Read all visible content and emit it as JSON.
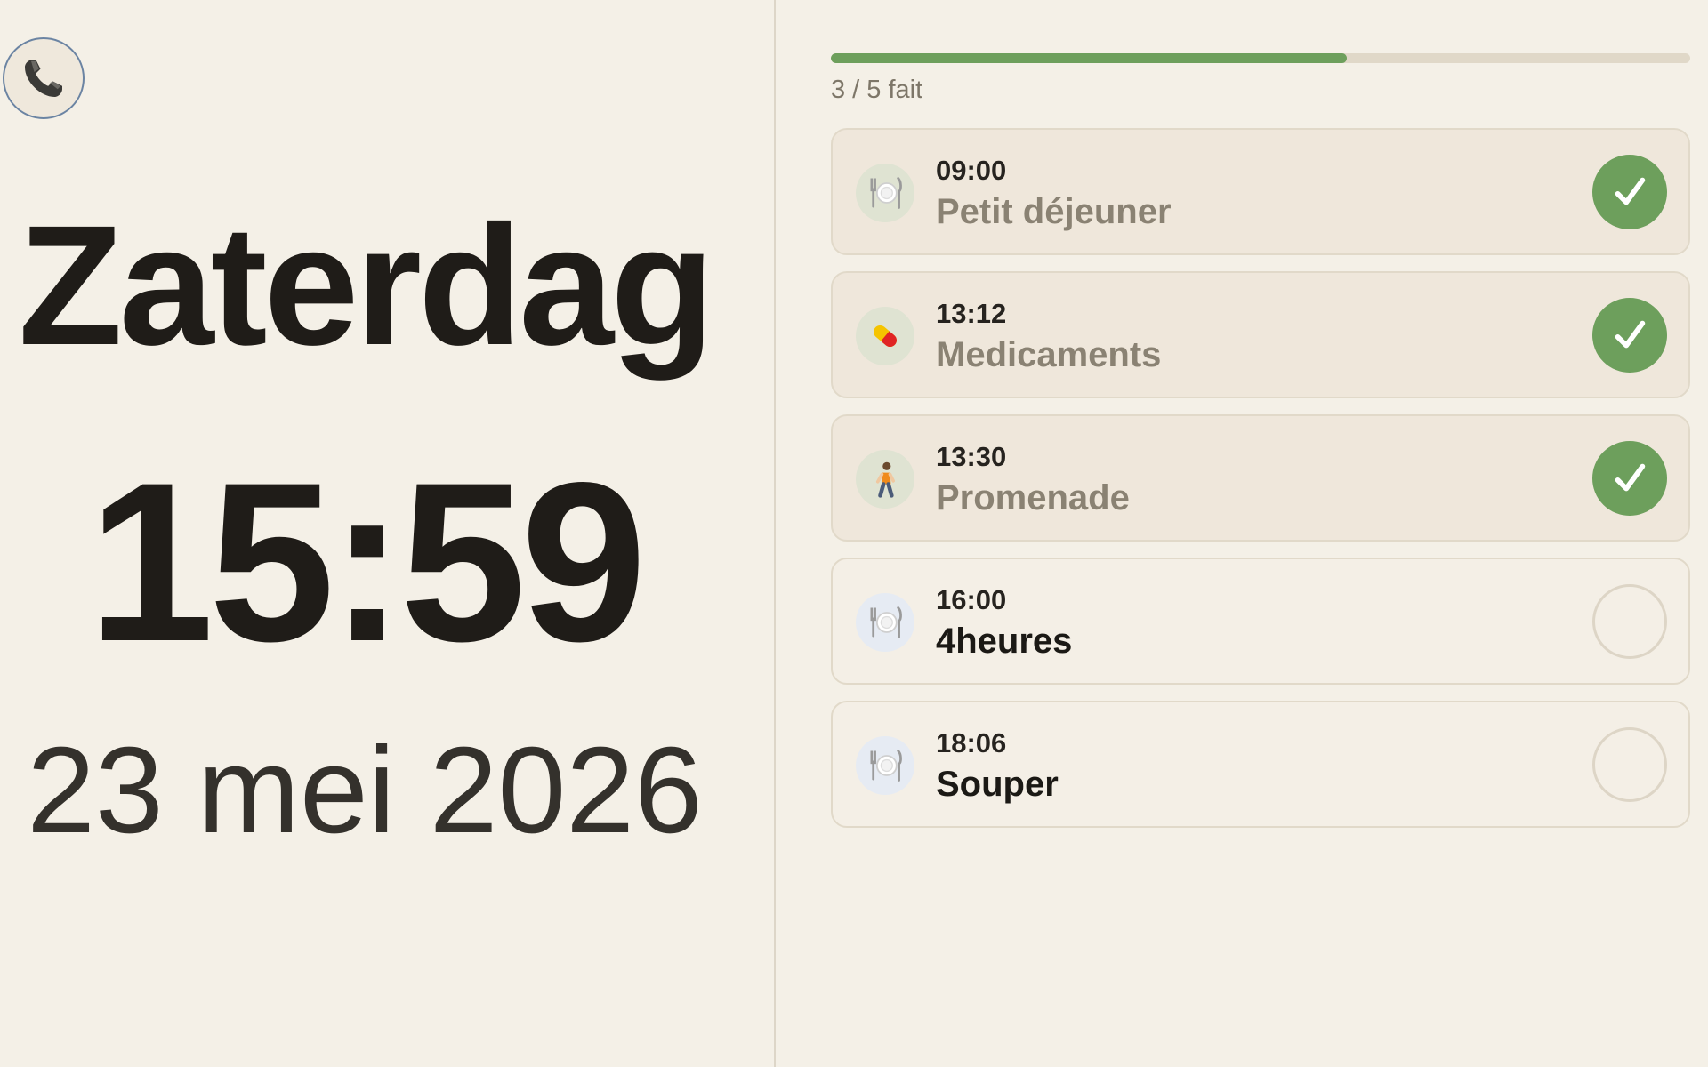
{
  "header": {
    "day": "Zaterdag",
    "time": "15:59",
    "date": "23 mei 2026"
  },
  "call_button": {
    "icon": "phone-icon"
  },
  "progress": {
    "label": "3 / 5 fait",
    "completed": 3,
    "total": 5
  },
  "tasks": [
    {
      "time": "09:00",
      "title": "Petit déjeuner",
      "icon": "plate-icon",
      "done": true
    },
    {
      "time": "13:12",
      "title": "Medicaments",
      "icon": "pill-icon",
      "done": true
    },
    {
      "time": "13:30",
      "title": "Promenade",
      "icon": "walking-person-icon",
      "done": true
    },
    {
      "time": "16:00",
      "title": "4heures",
      "icon": "plate-icon",
      "done": false
    },
    {
      "time": "18:06",
      "title": "Souper",
      "icon": "plate-icon",
      "done": false
    }
  ],
  "colors": {
    "background": "#f4f0e7",
    "accent_green": "#6d9f5c",
    "call_border": "#6b84a3",
    "text_dark": "#1f1c18",
    "text_muted": "#8a8273"
  }
}
